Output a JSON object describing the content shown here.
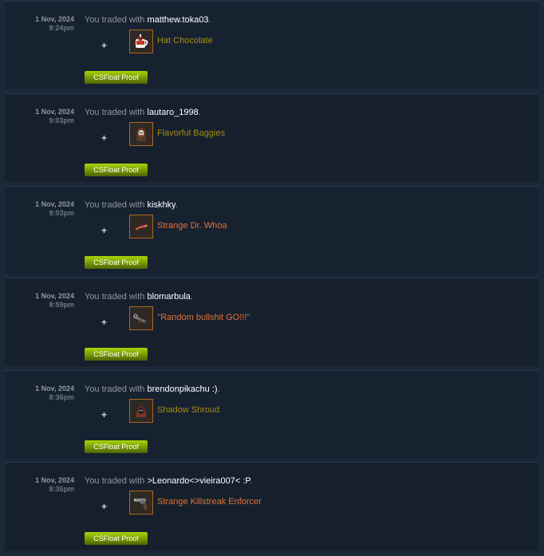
{
  "trade_prefix": "You traded with",
  "trades": [
    {
      "date": "1 Nov, 2024",
      "time": "9:24pm",
      "partner": "matthew.toka03",
      "suffix": ".",
      "plus": "+",
      "item": {
        "name": "Hat Chocolate",
        "quality": "unique",
        "icon": "hat-chocolate-icon"
      },
      "button": "CSFloat Proof"
    },
    {
      "date": "1 Nov, 2024",
      "time": "9:03pm",
      "partner": "lautaro_1998",
      "suffix": ".",
      "plus": "+",
      "item": {
        "name": "Flavorful Baggies",
        "quality": "unique",
        "icon": "flavorful-baggies-icon"
      },
      "button": "CSFloat Proof"
    },
    {
      "date": "1 Nov, 2024",
      "time": "9:03pm",
      "partner": "kiskhky",
      "suffix": ".",
      "plus": "+",
      "item": {
        "name": "Strange Dr. Whoa",
        "quality": "strange",
        "icon": "dr-whoa-icon"
      },
      "button": "CSFloat Proof"
    },
    {
      "date": "1 Nov, 2024",
      "time": "8:59pm",
      "partner": "blomarbula",
      "suffix": ".",
      "plus": "+",
      "item": {
        "name": "''Random bullshit GO!!!''",
        "quality": "strange",
        "icon": "rocket-launcher-icon"
      },
      "button": "CSFloat Proof"
    },
    {
      "date": "1 Nov, 2024",
      "time": "8:36pm",
      "partner": "brendonpikachu :)",
      "suffix": ".",
      "plus": "+",
      "item": {
        "name": "Shadow Shroud",
        "quality": "unique",
        "icon": "shadow-shroud-icon"
      },
      "button": "CSFloat Proof"
    },
    {
      "date": "1 Nov, 2024",
      "time": "8:36pm",
      "partner": ">Leonardo<>vieira007< :P",
      "suffix": ".",
      "plus": "+",
      "item": {
        "name": "Strange Killstreak Enforcer",
        "quality": "strange",
        "icon": "enforcer-revolver-icon"
      },
      "button": "CSFloat Proof"
    }
  ],
  "colors": {
    "background": "#1b2838",
    "row": "#16202d",
    "unique": "#a48c10",
    "strange": "#e07236",
    "button_top": "#a4d007",
    "button_bottom": "#536904"
  }
}
